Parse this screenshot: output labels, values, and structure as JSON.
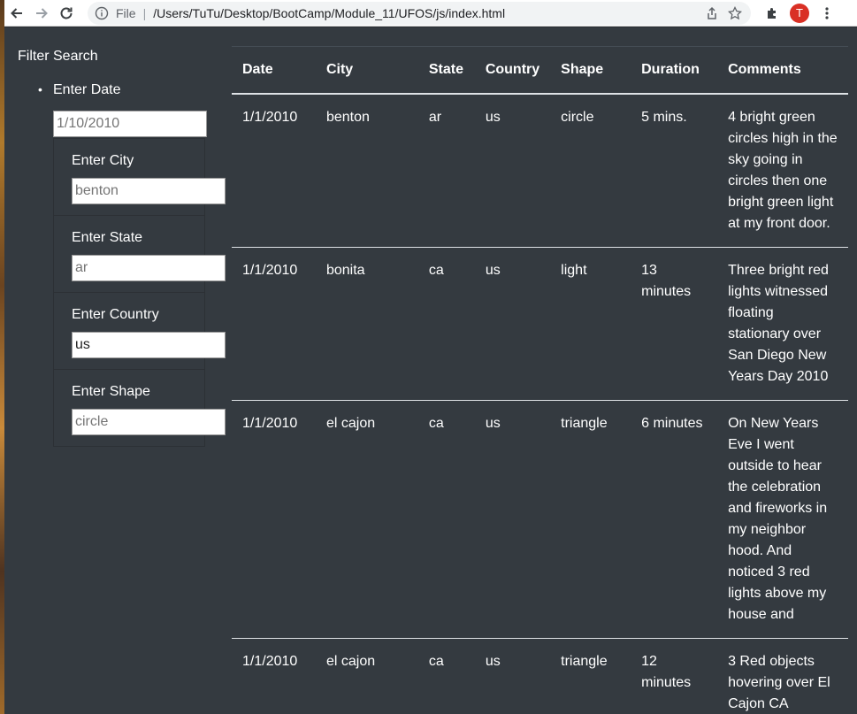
{
  "browser": {
    "scheme_label": "File",
    "url": "/Users/TuTu/Desktop/BootCamp/Module_11/UFOS/js/index.html",
    "avatar_letter": "T",
    "avatar_color": "#d93025"
  },
  "sidebar": {
    "title": "Filter Search",
    "date_label": "Enter Date",
    "date_placeholder": "1/10/2010",
    "city_label": "Enter City",
    "city_placeholder": "benton",
    "state_label": "Enter State",
    "state_placeholder": "ar",
    "country_label": "Enter Country",
    "country_value": "us",
    "shape_label": "Enter Shape",
    "shape_placeholder": "circle"
  },
  "table": {
    "headers": [
      "Date",
      "City",
      "State",
      "Country",
      "Shape",
      "Duration",
      "Comments"
    ],
    "rows": [
      [
        "1/1/2010",
        "benton",
        "ar",
        "us",
        "circle",
        "5 mins.",
        "4 bright green circles high in the sky going in circles then one bright green light at my front door."
      ],
      [
        "1/1/2010",
        "bonita",
        "ca",
        "us",
        "light",
        "13 minutes",
        "Three bright red lights witnessed floating stationary over San Diego New Years Day 2010"
      ],
      [
        "1/1/2010",
        "el cajon",
        "ca",
        "us",
        "triangle",
        "6 minutes",
        "On New Years Eve I went outside to hear the celebration and fireworks in my neighbor hood. And noticed 3 red lights above my house and"
      ],
      [
        "1/1/2010",
        "el cajon",
        "ca",
        "us",
        "triangle",
        "12 minutes",
        "3 Red objects hovering over El Cajon CA"
      ]
    ]
  }
}
